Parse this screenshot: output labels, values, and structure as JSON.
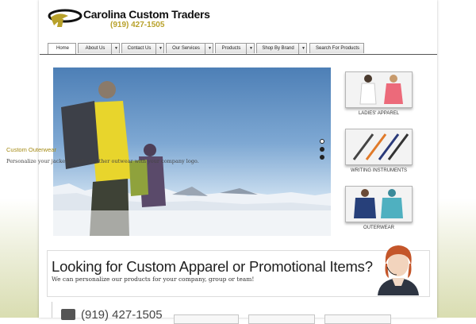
{
  "header": {
    "company_name": "Carolina Custom Traders",
    "phone": "(919) 427-1505"
  },
  "nav": {
    "items": [
      {
        "label": "Home",
        "has_dropdown": false,
        "active": true
      },
      {
        "label": "About Us",
        "has_dropdown": true,
        "active": false
      },
      {
        "label": "Contact Us",
        "has_dropdown": true,
        "active": false
      },
      {
        "label": "Our Services",
        "has_dropdown": true,
        "active": false
      },
      {
        "label": "Products",
        "has_dropdown": true,
        "active": false
      },
      {
        "label": "Shop By Brand",
        "has_dropdown": true,
        "active": false
      },
      {
        "label": "Search For Products",
        "has_dropdown": false,
        "active": false
      }
    ],
    "dropdown_icon": "caret-down-icon"
  },
  "slider": {
    "caption_title": "Custom Outerwear",
    "caption_text": "Personalize your jackets, coats or other outwear with your company logo.",
    "slide_count": 3,
    "active_slide": 1
  },
  "categories": [
    {
      "label": "LADIES' APPAREL"
    },
    {
      "label": "WRITING INSTRUMENTS"
    },
    {
      "label": "OUTERWEAR"
    }
  ],
  "banner": {
    "title": "Looking for Custom Apparel or Promotional Items?",
    "subtitle": "We can personalize our products for your company, group or team!"
  },
  "footer": {
    "phone": "(919) 427-1505",
    "phone_icon": "phone-icon"
  },
  "colors": {
    "accent": "#b8a12a",
    "caption_title": "#a48a14",
    "nav_border": "#9a9a9a",
    "text_dark": "#1f1f1f"
  }
}
